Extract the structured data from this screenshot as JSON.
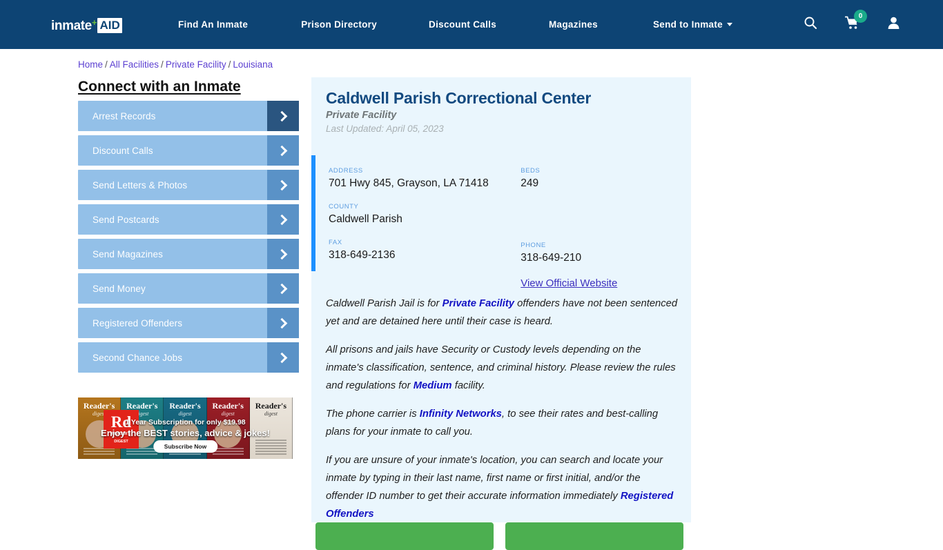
{
  "header": {
    "brand": {
      "text": "inmate",
      "plus": "+",
      "aid": "AID"
    },
    "nav": [
      {
        "label": "Find An Inmate"
      },
      {
        "label": "Prison Directory"
      },
      {
        "label": "Discount Calls"
      },
      {
        "label": "Magazines"
      },
      {
        "label": "Send to Inmate"
      }
    ],
    "icons": {
      "search": "search-icon",
      "cart": "cart-icon",
      "account": "user-icon"
    },
    "cart_count": "0",
    "bg_color": "#0d4474",
    "badge_color": "#1aab8a"
  },
  "breadcrumb": {
    "items": [
      "Home",
      "All Facilities",
      "Private Facility",
      "Louisiana"
    ],
    "separator": "/"
  },
  "sidebar": {
    "title": "Connect with an Inmate",
    "items": [
      {
        "label": "Arrest Records",
        "active": true
      },
      {
        "label": "Discount Calls",
        "active": false
      },
      {
        "label": "Send Letters & Photos",
        "active": false
      },
      {
        "label": "Send Postcards",
        "active": false
      },
      {
        "label": "Send Magazines",
        "active": false
      },
      {
        "label": "Send Money",
        "active": false
      },
      {
        "label": "Registered Offenders",
        "active": false
      },
      {
        "label": "Second Chance Jobs",
        "active": false
      }
    ],
    "button_color": "#93c0e8",
    "arrow_color": "#5a92c7",
    "arrow_active_color": "#2a5580"
  },
  "ad": {
    "brand_big": "Rd",
    "brand_small_1": "READER'S",
    "brand_small_2": "DIGEST",
    "line1": "1 Year Subscription for only $19.98",
    "line2": "Enjoy the BEST stories, advice & jokes!",
    "cta": "Subscribe Now",
    "covers": [
      {
        "mast": "Reader's",
        "sub": "digest"
      },
      {
        "mast": "Reader's",
        "sub": "digest"
      },
      {
        "mast": "Reader's",
        "sub": "digest"
      },
      {
        "mast": "Reader's",
        "sub": "digest"
      },
      {
        "mast": "Reader's",
        "sub": "digest"
      }
    ]
  },
  "facility": {
    "name": "Caldwell Parish Correctional Center",
    "type": "Private Facility",
    "last_updated": "Last Updated: April 05, 2023",
    "accent_color": "#1e90ff",
    "card_bg": "#eaf6fd",
    "fields": {
      "address_label": "ADDRESS",
      "address_value": "701 Hwy 845, Grayson, LA 71418",
      "beds_label": "BEDS",
      "beds_value": "249",
      "county_label": "COUNTY",
      "county_value": "Caldwell Parish",
      "phone_label": "PHONE",
      "phone_value": "318-649-210",
      "fax_label": "FAX",
      "fax_value": "318-649-2136",
      "website_link": "View Official Website"
    }
  },
  "body": {
    "p1_a": "Caldwell Parish Jail is for ",
    "p1_b": "Private Facility",
    "p1_c": " offenders have not been sentenced yet and are detained here until their case is heard.",
    "p2_a": "All prisons and jails have Security or Custody levels depending on the inmate's classification, sentence, and criminal history. Please review the rules and regulations for ",
    "p2_b": "Medium",
    "p2_c": " facility.",
    "p3_a": "The phone carrier is ",
    "p3_b": "Infinity Networks",
    "p3_c": ", to see their rates and best-calling plans for your inmate to call you.",
    "p4_a": "If you are unsure of your inmate's location, you can search and locate your inmate by typing in their last name, first name or first initial, and/or the offender ID number to get their accurate information immediately ",
    "p4_link": "Registered Offenders"
  },
  "cta": {
    "button_1": "",
    "button_2": "",
    "color": "#4caf50"
  }
}
